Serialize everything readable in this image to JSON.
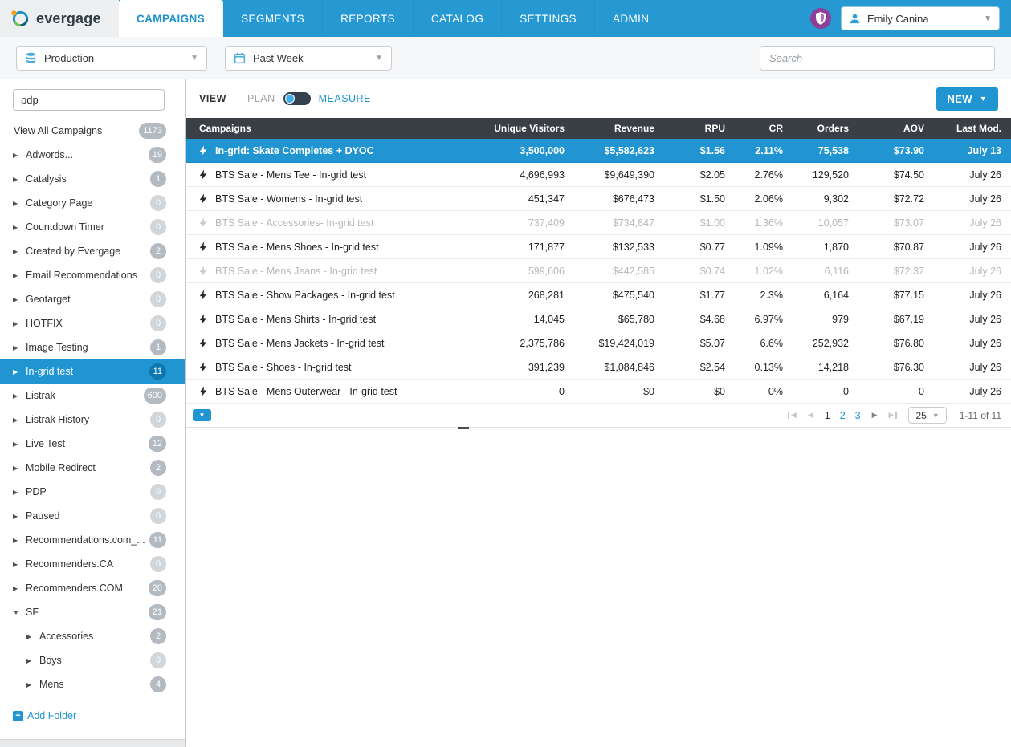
{
  "colors": {
    "nav": "#2799d2",
    "accent": "#2095d2",
    "table_header_bg": "#3a3f45",
    "selected_row_bg": "#2095d2"
  },
  "topnav": {
    "brand": "evergage",
    "tabs": [
      {
        "label": "CAMPAIGNS",
        "active": true
      },
      {
        "label": "SEGMENTS",
        "active": false
      },
      {
        "label": "REPORTS",
        "active": false
      },
      {
        "label": "CATALOG",
        "active": false
      },
      {
        "label": "SETTINGS",
        "active": false
      },
      {
        "label": "ADMIN",
        "active": false
      }
    ],
    "user_name": "Emily Canina"
  },
  "toolbar": {
    "environment": "Production",
    "date_range": "Past Week",
    "search_placeholder": "Search"
  },
  "sidebar": {
    "filter_value": "pdp",
    "view_all": {
      "label": "View All Campaigns",
      "count": "1173"
    },
    "folders": [
      {
        "label": "Adwords...",
        "count": "19"
      },
      {
        "label": "Catalysis",
        "count": "1"
      },
      {
        "label": "Category Page",
        "count": "0"
      },
      {
        "label": "Countdown Timer",
        "count": "0"
      },
      {
        "label": "Created by Evergage",
        "count": "2"
      },
      {
        "label": "Email Recommendations",
        "count": "0"
      },
      {
        "label": "Geotarget",
        "count": "0"
      },
      {
        "label": "HOTFIX",
        "count": "0"
      },
      {
        "label": "Image Testing",
        "count": "1"
      },
      {
        "label": "In-grid test",
        "count": "11",
        "selected": true
      },
      {
        "label": "Listrak",
        "count": "600"
      },
      {
        "label": "Listrak History",
        "count": "0"
      },
      {
        "label": "Live Test",
        "count": "12"
      },
      {
        "label": "Mobile Redirect",
        "count": "2"
      },
      {
        "label": "PDP",
        "count": "0"
      },
      {
        "label": "Paused",
        "count": "0"
      },
      {
        "label": "Recommendations.com_...",
        "count": "11"
      },
      {
        "label": "Recommenders.CA",
        "count": "0"
      },
      {
        "label": "Recommenders.COM",
        "count": "20"
      },
      {
        "label": "SF",
        "count": "21",
        "expanded": true
      },
      {
        "label": "Accessories",
        "count": "2",
        "child": true
      },
      {
        "label": "Boys",
        "count": "0",
        "child": true
      },
      {
        "label": "Mens",
        "count": "4",
        "child": true
      }
    ],
    "add_folder_label": "Add Folder"
  },
  "main": {
    "view_label": "VIEW",
    "plan_label": "PLAN",
    "measure_label": "MEASURE",
    "new_button_label": "NEW",
    "table": {
      "columns": [
        "Campaigns",
        "Unique Visitors",
        "Revenue",
        "RPU",
        "CR",
        "Orders",
        "AOV",
        "Last Mod."
      ],
      "rows": [
        {
          "name": "In-grid: Skate Completes + DYOC",
          "visitors": "3,500,000",
          "revenue": "$5,582,623",
          "rpu": "$1.56",
          "cr": "2.11%",
          "orders": "75,538",
          "aov": "$73.90",
          "last_mod": "July 13",
          "state": "selected"
        },
        {
          "name": "BTS Sale - Mens Tee - In-grid test",
          "visitors": "4,696,993",
          "revenue": "$9,649,390",
          "rpu": "$2.05",
          "cr": "2.76%",
          "orders": "129,520",
          "aov": "$74.50",
          "last_mod": "July 26",
          "state": "active"
        },
        {
          "name": "BTS Sale - Womens - In-grid test",
          "visitors": "451,347",
          "revenue": "$676,473",
          "rpu": "$1.50",
          "cr": "2.06%",
          "orders": "9,302",
          "aov": "$72.72",
          "last_mod": "July 26",
          "state": "active"
        },
        {
          "name": "BTS Sale - Accessories- In-grid test",
          "visitors": "737,409",
          "revenue": "$734,847",
          "rpu": "$1.00",
          "cr": "1.36%",
          "orders": "10,057",
          "aov": "$73.07",
          "last_mod": "July 26",
          "state": "inactive"
        },
        {
          "name": "BTS Sale - Mens Shoes - In-grid test",
          "visitors": "171,877",
          "revenue": "$132,533",
          "rpu": "$0.77",
          "cr": "1.09%",
          "orders": "1,870",
          "aov": "$70.87",
          "last_mod": "July 26",
          "state": "active"
        },
        {
          "name": "BTS Sale - Mens Jeans - In-grid test",
          "visitors": "599,606",
          "revenue": "$442,585",
          "rpu": "$0.74",
          "cr": "1.02%",
          "orders": "6,116",
          "aov": "$72.37",
          "last_mod": "July 26",
          "state": "inactive"
        },
        {
          "name": "BTS Sale - Show Packages - In-grid test",
          "visitors": "268,281",
          "revenue": "$475,540",
          "rpu": "$1.77",
          "cr": "2.3%",
          "orders": "6,164",
          "aov": "$77.15",
          "last_mod": "July 26",
          "state": "active"
        },
        {
          "name": "BTS Sale - Mens Shirts - In-grid test",
          "visitors": "14,045",
          "revenue": "$65,780",
          "rpu": "$4.68",
          "cr": "6.97%",
          "orders": "979",
          "aov": "$67.19",
          "last_mod": "July 26",
          "state": "active"
        },
        {
          "name": "BTS Sale - Mens Jackets - In-grid test",
          "visitors": "2,375,786",
          "revenue": "$19,424,019",
          "rpu": "$5.07",
          "cr": "6.6%",
          "orders": "252,932",
          "aov": "$76.80",
          "last_mod": "July 26",
          "state": "active"
        },
        {
          "name": "BTS Sale - Shoes - In-grid test",
          "visitors": "391,239",
          "revenue": "$1,084,846",
          "rpu": "$2.54",
          "cr": "0.13%",
          "orders": "14,218",
          "aov": "$76.30",
          "last_mod": "July 26",
          "state": "active"
        },
        {
          "name": "BTS Sale - Mens Outerwear - In-grid test",
          "visitors": "0",
          "revenue": "$0",
          "rpu": "$0",
          "cr": "0%",
          "orders": "0",
          "aov": "0",
          "last_mod": "July 26",
          "state": "active"
        }
      ]
    },
    "pagination": {
      "pages": [
        "1",
        "2",
        "3"
      ],
      "current_page": "1",
      "highlighted_page": "2",
      "page_size": "25",
      "range_label": "1-11 of 11"
    }
  }
}
